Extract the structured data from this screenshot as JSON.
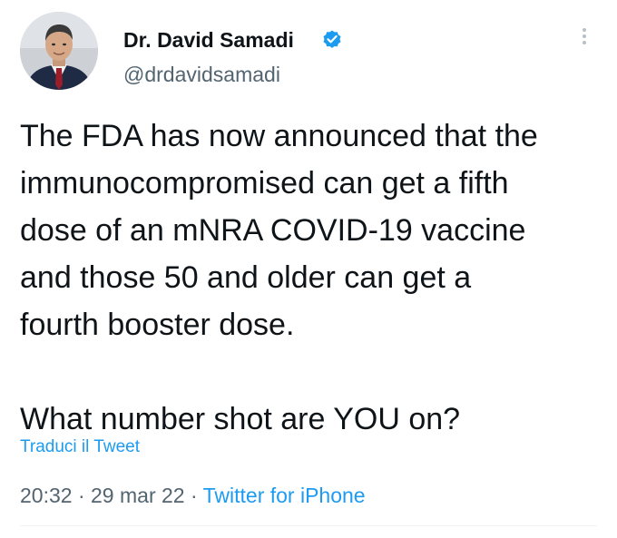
{
  "author": {
    "display_name": "Dr. David Samadi",
    "handle": "@drdavidsamadi",
    "verified_icon": "verified-badge-icon",
    "avatar_icon": "profile-photo"
  },
  "tweet": {
    "lines": [
      "The FDA has now announced that the",
      "immunocompromised can get a fifth",
      "dose of an mNRA COVID-19 vaccine",
      "and those 50 and older can get a",
      "fourth booster dose.",
      "",
      "What number shot are YOU on?"
    ],
    "translate_label": "Traduci il Tweet"
  },
  "meta": {
    "time": "20:32",
    "separator": "·",
    "date": "29 mar 22",
    "source": "Twitter for iPhone"
  },
  "more_icon": "more-vertical-icon",
  "colors": {
    "text": "#0f1419",
    "secondary": "#536471",
    "accent": "#1d9bf0",
    "divider": "#eff3f4"
  }
}
